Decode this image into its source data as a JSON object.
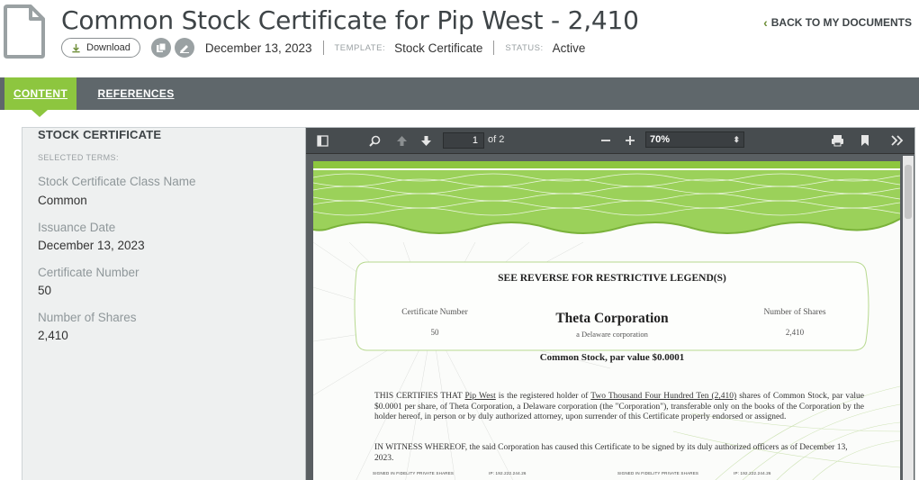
{
  "header": {
    "title": "Common Stock Certificate for Pip West - 2,410",
    "back_link": "BACK TO MY DOCUMENTS",
    "download_label": "Download",
    "date": "December 13, 2023",
    "template_label": "TEMPLATE:",
    "template_value": "Stock Certificate",
    "status_label": "STATUS:",
    "status_value": "Active"
  },
  "tabs": [
    {
      "label": "CONTENT",
      "active": true
    },
    {
      "label": "REFERENCES",
      "active": false
    }
  ],
  "left_panel": {
    "title": "STOCK CERTIFICATE",
    "subtitle": "SELECTED TERMS:",
    "terms": [
      {
        "label": "Stock Certificate Class Name",
        "value": "Common"
      },
      {
        "label": "Issuance Date",
        "value": "December 13, 2023"
      },
      {
        "label": "Certificate Number",
        "value": "50"
      },
      {
        "label": "Number of Shares",
        "value": "2,410"
      }
    ]
  },
  "viewer": {
    "page_current": "1",
    "page_of": "of 2",
    "zoom": "70%"
  },
  "certificate": {
    "restrictive": "SEE REVERSE FOR RESTRICTIVE LEGEND(S)",
    "cert_number_label": "Certificate Number",
    "cert_number_value": "50",
    "company": "Theta Corporation",
    "company_sub": "a Delaware corporation",
    "shares_label": "Number of Shares",
    "shares_value": "2,410",
    "stock_type": "Common Stock, par value $0.0001",
    "certifies_1": "THIS CERTIFIES THAT ",
    "holder": "Pip West",
    "certifies_2": " is the registered holder of ",
    "shares_words": "Two Thousand Four Hundred Ten (2,410)",
    "certifies_3": " shares of Common Stock, par value $0.0001 per share, of Theta Corporation, a Delaware corporation (the \"Corporation\"), transferable only on the books of the Corporation by the holder hereof, in person or by duly authorized attorney, upon surrender of this Certificate properly endorsed or assigned.",
    "witness": "IN WITNESS WHEREOF, the said Corporation has caused this Certificate to be signed by its duly authorized officers as of December 13, 2023.",
    "sig_1": "SIGNED IN FIDELITY PRIVATE SHARES",
    "sig_1_ip": "IP: 192.222.244.26",
    "sig_2": "SIGNED IN FIDELITY PRIVATE SHARES",
    "sig_2_ip": "IP: 192.222.244.26"
  },
  "colors": {
    "accent_green": "#8dc63f",
    "tabbar_gray": "#5f676b",
    "toolbar_dark": "#474c4f"
  }
}
